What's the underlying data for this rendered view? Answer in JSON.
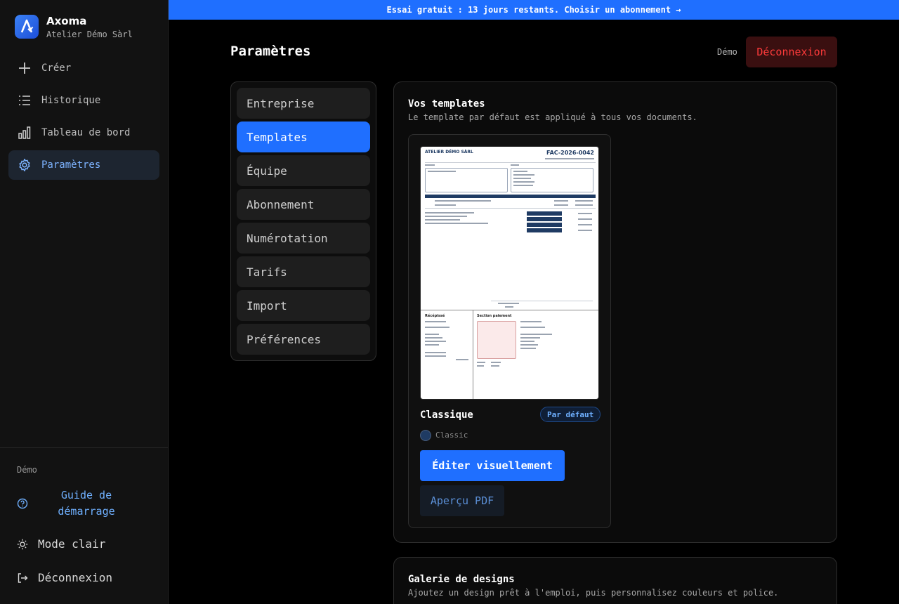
{
  "brand": {
    "name": "Axoma",
    "company": "Atelier Démo Sàrl"
  },
  "nav": [
    {
      "label": "Créer",
      "icon": "plus-icon"
    },
    {
      "label": "Historique",
      "icon": "list-icon"
    },
    {
      "label": "Tableau de bord",
      "icon": "bar-chart-icon"
    },
    {
      "label": "Paramètres",
      "icon": "gear-icon",
      "active": true
    }
  ],
  "sidebar_bottom": {
    "label": "Démo",
    "guide": "Guide de démarrage",
    "theme": "Mode clair",
    "logout": "Déconnexion"
  },
  "banner": "Essai gratuit : 13 jours restants. Choisir un abonnement →",
  "header": {
    "title": "Paramètres",
    "user": "Démo",
    "logout": "Déconnexion"
  },
  "settings_menu": [
    {
      "label": "Entreprise"
    },
    {
      "label": "Templates",
      "active": true
    },
    {
      "label": "Équipe"
    },
    {
      "label": "Abonnement"
    },
    {
      "label": "Numérotation"
    },
    {
      "label": "Tarifs"
    },
    {
      "label": "Import"
    },
    {
      "label": "Préférences"
    }
  ],
  "templates": {
    "title": "Vos templates",
    "subtitle": "Le template par défaut est appliqué à tous vos documents.",
    "card": {
      "name": "Classique",
      "badge": "Par défaut",
      "style": "Classic",
      "swatch_color": "#1f3b63",
      "edit_button": "Éditer visuellement",
      "pdf_button": "Aperçu PDF",
      "preview": {
        "company": "ATELIER DÉMO SÀRL",
        "number": "FAC-2026-0042",
        "payment_section": "Section paiement",
        "receipt": "Récépissé"
      }
    }
  },
  "gallery": {
    "title": "Galerie de designs",
    "subtitle": "Ajoutez un design prêt à l'emploi, puis personnalisez couleurs et police."
  }
}
